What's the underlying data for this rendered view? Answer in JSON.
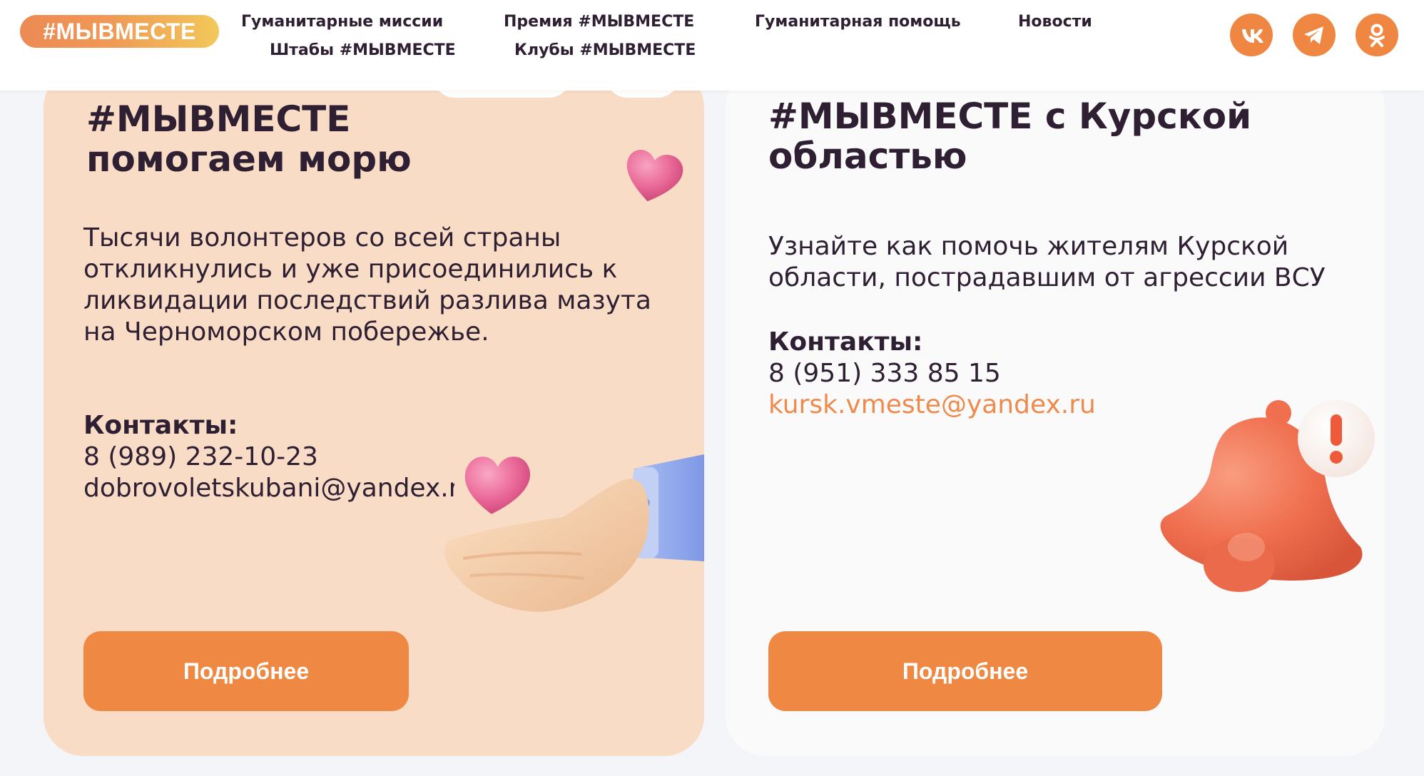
{
  "header": {
    "logo": "#МЫВМЕСТЕ",
    "nav": [
      "Гуманитарные миссии",
      "Премия #МЫВМЕСТЕ",
      "Гуманитарная помощь",
      "Новости",
      "Штабы #МЫВМЕСТЕ",
      "Клубы #МЫВМЕСТЕ"
    ],
    "social": [
      "vk-icon",
      "telegram-icon",
      "odnoklassniki-icon"
    ]
  },
  "cards": [
    {
      "title_line1": "#МЫВМЕСТЕ",
      "title_line2": "помогаем морю",
      "text": "Тысячи волонтеров со всей страны откликнулись и уже присоединились к ликвидации последствий разлива мазута на Черноморском побережье.",
      "contacts_label": "Контакты:",
      "phone": "8 (989) 232-10-23",
      "email": "dobrovoletskubani@yandex.ru",
      "button": "Подробнее",
      "illustration": "hand-with-heart"
    },
    {
      "title": "#МЫВМЕСТЕ с Курской областью",
      "text": "Узнайте как помочь жителям Курской области, пострадавшим от агрессии ВСУ",
      "contacts_label": "Контакты:",
      "phone": "8 (951) 333 85 15",
      "email": "kursk.vmeste@yandex.ru",
      "button": "Подробнее",
      "illustration": "bell-with-exclamation"
    }
  ],
  "colors": {
    "accent": "#ef8842",
    "card_left_bg": "#f8dcc5",
    "card_right_bg": "#fafafb",
    "page_bg": "#f3f5f9",
    "text": "#2f1f33",
    "link": "#ef8a4d"
  }
}
